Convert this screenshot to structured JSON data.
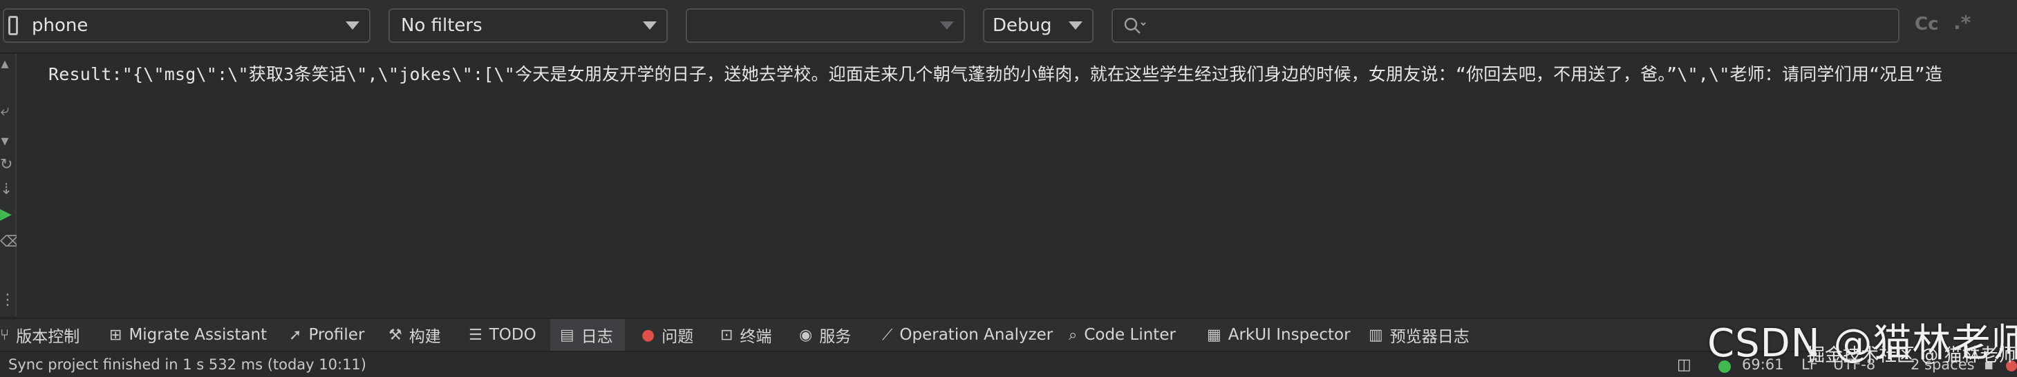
{
  "toolbar": {
    "device_value": "phone",
    "filter_value": "No filters",
    "process_value": "",
    "level_value": "Debug",
    "search_placeholder": "",
    "match_case_label": "Cc",
    "regex_label": ".*"
  },
  "log": {
    "line": "Result:\"{\\\"msg\\\":\\\"获取3条笑话\\\",\\\"jokes\\\":[\\\"今天是女朋友开学的日子，送她去学校。迎面走来几个朝气蓬勃的小鲜肉，就在这些学生经过我们身边的时候，女朋友说：“你回去吧，不用送了，爸。”\\\",\\\"老师：请同学们用“况且”造"
  },
  "tabs": [
    {
      "label": "版本控制",
      "icon": "branch-icon"
    },
    {
      "label": "Migrate Assistant",
      "icon": "migrate-icon"
    },
    {
      "label": "Profiler",
      "icon": "profiler-icon"
    },
    {
      "label": "构建",
      "icon": "hammer-icon"
    },
    {
      "label": "TODO",
      "icon": "list-icon"
    },
    {
      "label": "日志",
      "icon": "log-icon",
      "active": true
    },
    {
      "label": "问题",
      "icon": "error-icon"
    },
    {
      "label": "终端",
      "icon": "terminal-icon"
    },
    {
      "label": "服务",
      "icon": "play-icon"
    },
    {
      "label": "Operation Analyzer",
      "icon": "chart-icon"
    },
    {
      "label": "Code Linter",
      "icon": "search-icon"
    },
    {
      "label": "ArkUI Inspector",
      "icon": "grid-icon"
    },
    {
      "label": "预览器日志",
      "icon": "doc-icon"
    }
  ],
  "status": {
    "message": "Sync project finished in 1 s 532 ms (today 10:11)",
    "position": "69:61",
    "line_sep": "LF",
    "encoding": "UTF-8",
    "indent": "2 spaces"
  },
  "watermark": {
    "main": "CSDN @猫林老师",
    "sub": "掘金技术社区 @ 猫林老师"
  },
  "colors": {
    "background": "#2b2b2d",
    "active_tab": "#3d3f43",
    "ok_green": "#3fb950",
    "error_red": "#e0504a"
  }
}
